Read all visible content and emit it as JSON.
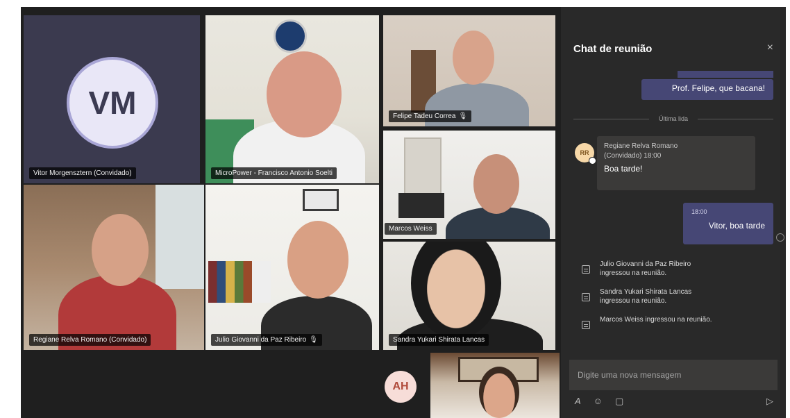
{
  "participants": {
    "vitor": {
      "initials": "VM",
      "name": "Vitor Morgensztern (Convidado)"
    },
    "francisco": {
      "name": "MicroPower - Francisco Antonio Soelti"
    },
    "felipe": {
      "name": "Felipe Tadeu Correa"
    },
    "marcos": {
      "name": "Marcos Weiss"
    },
    "regiane": {
      "name": "Regiane Relva Romano (Convidado)"
    },
    "julio": {
      "name": "Julio Giovanni da Paz Ribeiro"
    },
    "sandra": {
      "name": "Sandra Yukari Shirata Lancas"
    },
    "ah": {
      "initials": "AH"
    }
  },
  "chat": {
    "title": "Chat de reunião",
    "close_icon": "×",
    "msg_felipe": "Prof. Felipe, que bacana!",
    "last_read": "Última lida",
    "other_msg": {
      "avatar": "RR",
      "sender_line1": "Regiane Relva Romano",
      "sender_line2": "(Convidado)   18:00",
      "text": "Boa tarde!"
    },
    "my_msg": {
      "time": "18:00",
      "text": "Vitor, boa tarde"
    },
    "system": [
      {
        "text": "Julio Giovanni da Paz Ribeiro ingressou na reunião."
      },
      {
        "text": "Sandra Yukari Shirata Lancas ingressou na reunião."
      },
      {
        "text": "Marcos Weiss ingressou na reunião."
      }
    ],
    "compose_placeholder": "Digite uma nova mensagem",
    "tools": {
      "format": "A",
      "emoji": "☺",
      "sticker": "▢"
    },
    "send_icon": "▷"
  },
  "colors": {
    "accent": "#464775",
    "panel": "#292929",
    "stage": "#1f1f1f"
  }
}
